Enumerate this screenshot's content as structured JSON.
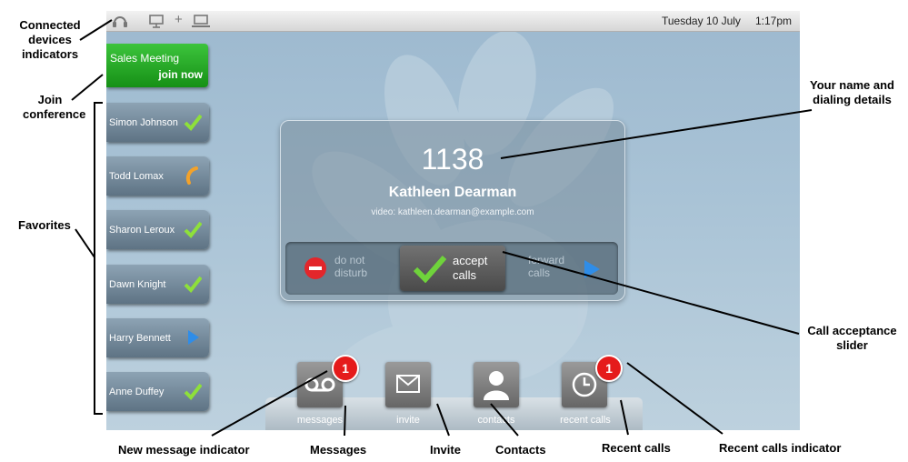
{
  "status_bar": {
    "date": "Tuesday 10 July",
    "time": "1:17pm",
    "device_plus": "+"
  },
  "conference": {
    "title": "Sales Meeting",
    "join_label": "join now"
  },
  "favorites": [
    {
      "name": "Simon Johnson",
      "status": "available"
    },
    {
      "name": "Todd Lomax",
      "status": "on-call"
    },
    {
      "name": "Sharon Leroux",
      "status": "available"
    },
    {
      "name": "Dawn Knight",
      "status": "available"
    },
    {
      "name": "Harry Bennett",
      "status": "forwarded"
    },
    {
      "name": "Anne Duffey",
      "status": "available"
    }
  ],
  "caller": {
    "number": "1138",
    "name": "Kathleen Dearman",
    "video": "video: kathleen.dearman@example.com"
  },
  "slider": {
    "dnd": "do not disturb",
    "accept": "accept calls",
    "forward": "forward calls"
  },
  "toolbar": {
    "messages": "messages",
    "invite": "invite",
    "contacts": "contacts",
    "recent_calls": "recent calls",
    "messages_badge": "1",
    "recent_badge": "1"
  },
  "annotations": {
    "connected": "Connected devices indicators",
    "join": "Join conference",
    "favorites": "Favorites",
    "your_name": "Your name and dialing details",
    "call_acceptance": "Call acceptance slider",
    "new_message": "New message indicator",
    "messages": "Messages",
    "invite": "Invite",
    "contacts": "Contacts",
    "recent_calls": "Recent calls",
    "recent_indicator": "Recent calls indicator"
  },
  "colors": {
    "accent_green": "#1a9a1a",
    "badge_red": "#e51b1b",
    "screen_blue": "#a9c3d6"
  }
}
